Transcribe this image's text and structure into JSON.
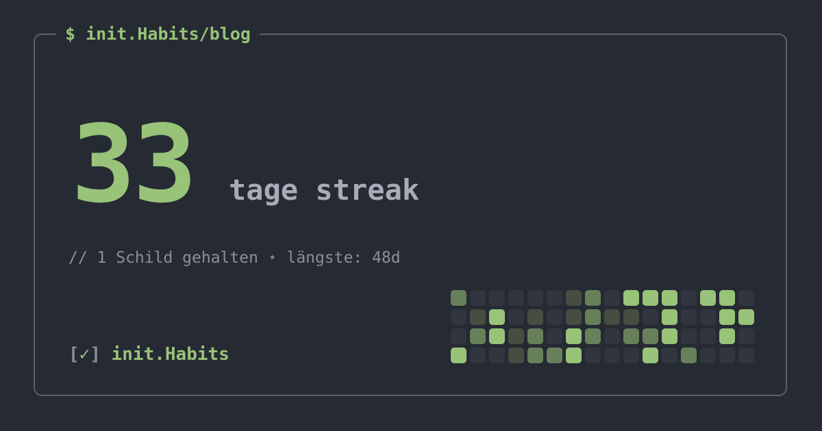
{
  "header": {
    "title": "$ init.Habits/blog"
  },
  "streak": {
    "count": "33",
    "label": "tage streak",
    "subline": "// 1 Schild gehalten ⋆ längste: 48d"
  },
  "brand": {
    "open_bracket": "[",
    "check": "✓",
    "close_bracket": "]",
    "name": "init.Habits"
  },
  "colors": {
    "background": "#262a33",
    "border": "#5a5f6b",
    "accent": "#98c379",
    "muted_text": "#8a8f9a",
    "label_text": "#a7acb8"
  },
  "activity": {
    "columns": 16,
    "level_colors": [
      "#31353f",
      "#454e41",
      "#67805a",
      "#98c379"
    ],
    "rows": [
      [
        2,
        0,
        0,
        0,
        0,
        0,
        1,
        2,
        0,
        3,
        3,
        3,
        0,
        3,
        3,
        0
      ],
      [
        0,
        1,
        3,
        0,
        1,
        0,
        1,
        2,
        1,
        1,
        0,
        3,
        0,
        0,
        3,
        3
      ],
      [
        0,
        2,
        3,
        1,
        2,
        0,
        3,
        2,
        0,
        2,
        2,
        3,
        0,
        0,
        3,
        0
      ],
      [
        3,
        0,
        0,
        1,
        2,
        2,
        3,
        0,
        0,
        0,
        3,
        0,
        2,
        0,
        0,
        0
      ]
    ]
  }
}
